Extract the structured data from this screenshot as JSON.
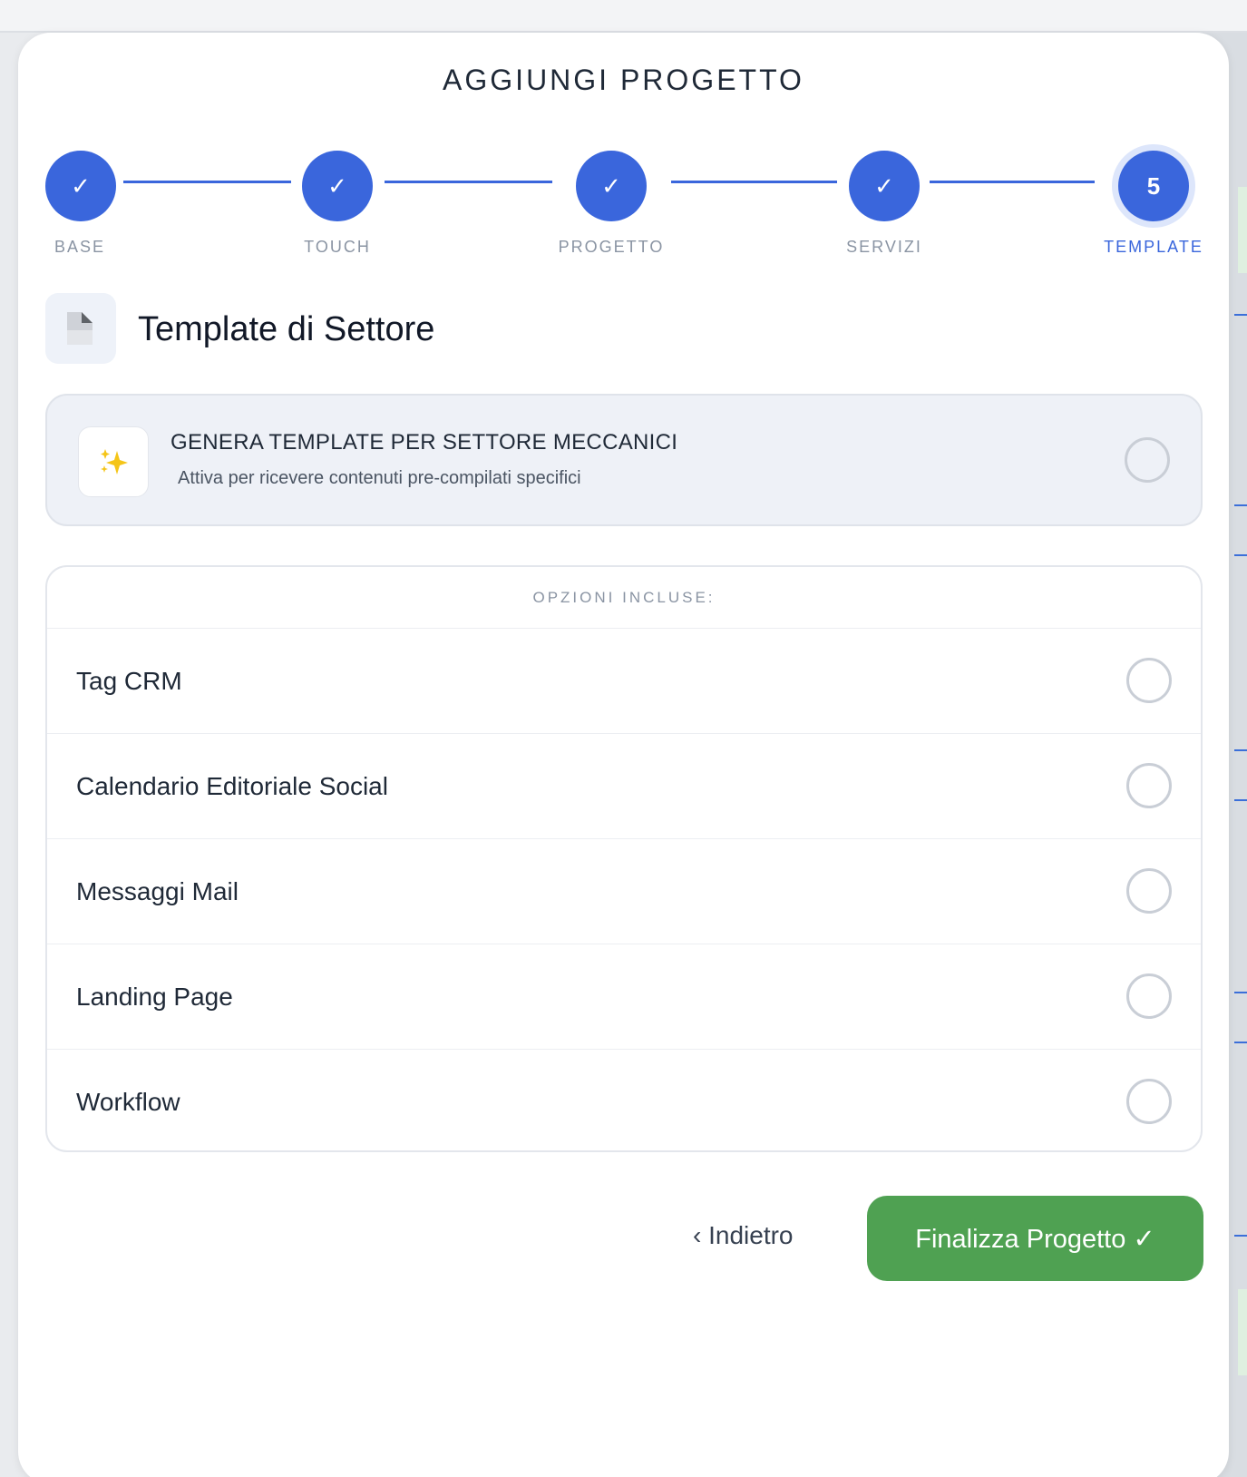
{
  "modal": {
    "title": "AGGIUNGI PROGETTO"
  },
  "stepper": {
    "steps": [
      {
        "label": "BASE",
        "mark": "✓",
        "state": "done"
      },
      {
        "label": "TOUCH",
        "mark": "✓",
        "state": "done"
      },
      {
        "label": "PROGETTO",
        "mark": "✓",
        "state": "done"
      },
      {
        "label": "SERVIZI",
        "mark": "✓",
        "state": "done"
      },
      {
        "label": "TEMPLATE",
        "mark": "5",
        "state": "active"
      }
    ]
  },
  "section": {
    "title": "Template di Settore",
    "icon": "document-icon"
  },
  "generate": {
    "title": "GENERA TEMPLATE PER SETTORE MECCANICI",
    "subtitle": "Attiva per ricevere contenuti pre-compilati specifici",
    "icon": "sparkles-icon",
    "checked": false
  },
  "options": {
    "header": "OPZIONI INCLUSE:",
    "items": [
      {
        "label": "Tag CRM",
        "checked": false
      },
      {
        "label": "Calendario Editoriale Social",
        "checked": false
      },
      {
        "label": "Messaggi Mail",
        "checked": false
      },
      {
        "label": "Landing Page",
        "checked": false
      },
      {
        "label": "Workflow",
        "checked": false
      }
    ]
  },
  "footer": {
    "back_label": "‹ Indietro",
    "finish_label": "Finalizza Progetto ✓"
  },
  "colors": {
    "accent": "#3a66dc",
    "success": "#4fa152"
  }
}
